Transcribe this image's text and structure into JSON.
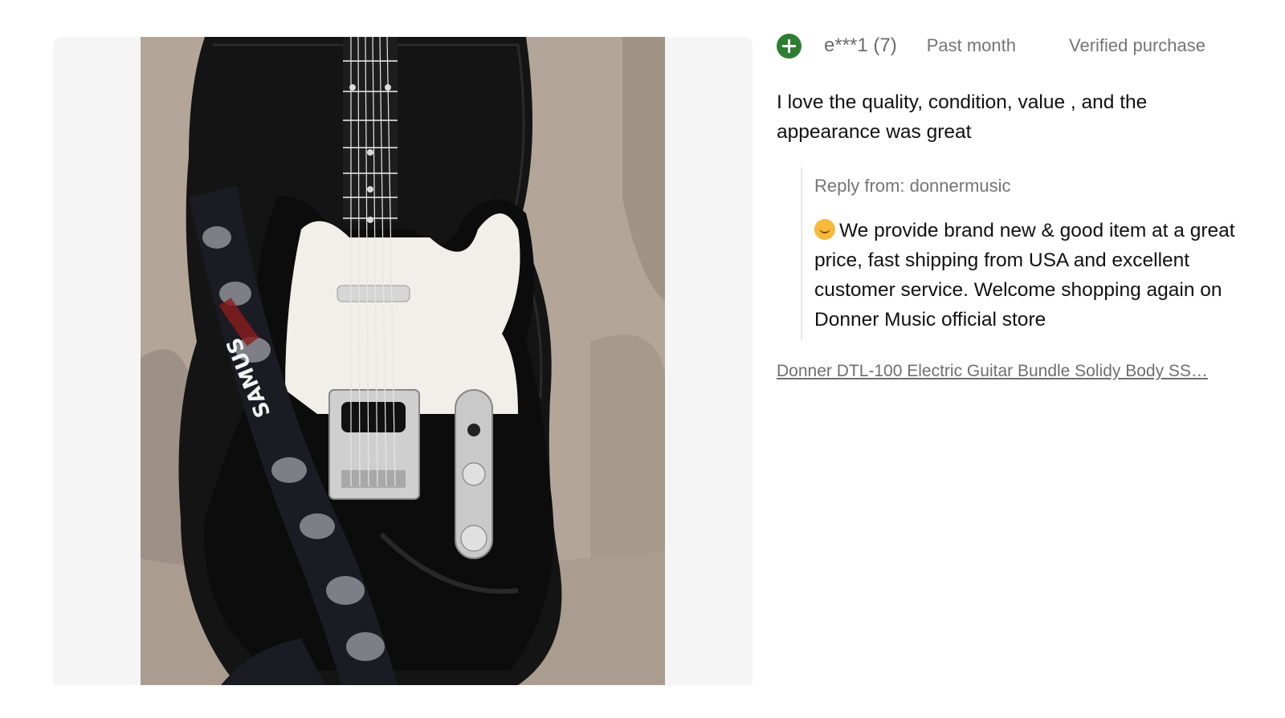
{
  "review": {
    "username": "e***1 (7)",
    "date": "Past month",
    "verified": "Verified purchase",
    "body": "I love the quality, condition, value , and the appearance was great",
    "reply": {
      "label": "Reply from: donnermusic",
      "text": "We provide brand new & good item at a great price, fast shipping from USA and excellent customer service. Welcome shopping again on Donner Music official store"
    },
    "product_link": "Donner DTL-100 Electric Guitar Bundle Solidy Body SS…"
  },
  "photo": {
    "strap_text": "SAMUS"
  },
  "colors": {
    "avatar": "#2e7d32",
    "muted_text": "#757575",
    "photo_panel_bg": "#f5f5f5"
  },
  "icons": {
    "avatar": "plus-circle-icon",
    "emoji": "smiling-face-icon"
  }
}
